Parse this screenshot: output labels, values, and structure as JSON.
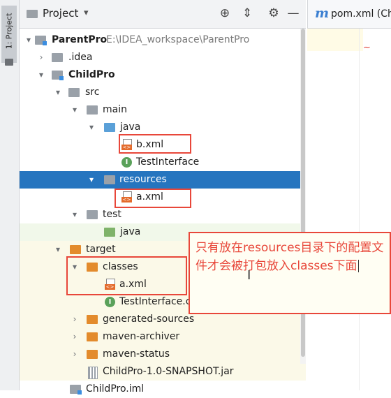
{
  "left_strip": {
    "project_tab_label": "1: Project"
  },
  "panel_header": {
    "title": "Project",
    "chevron": "▾",
    "buttons": [
      {
        "name": "locate-target-button",
        "glyph": "⊕"
      },
      {
        "name": "collapse-all-button",
        "glyph": "⇕"
      },
      {
        "name": "settings-button",
        "glyph": "⚙"
      },
      {
        "name": "hide-panel-button",
        "glyph": "—"
      }
    ]
  },
  "editor": {
    "tab_icon": "m",
    "tab_label": "pom.xml (Ch"
  },
  "tree": {
    "rows": [
      {
        "label": "ParentPro",
        "hint": "E:\\IDEA_workspace\\ParentPro"
      },
      {
        "label": ".idea"
      },
      {
        "label": "ChildPro"
      },
      {
        "label": "src"
      },
      {
        "label": "main"
      },
      {
        "label": "java"
      },
      {
        "label": "b.xml"
      },
      {
        "label": "TestInterface"
      },
      {
        "label": "resources"
      },
      {
        "label": "a.xml"
      },
      {
        "label": "test"
      },
      {
        "label": "java"
      },
      {
        "label": "target"
      },
      {
        "label": "classes"
      },
      {
        "label": "a.xml"
      },
      {
        "label": "TestInterface.class"
      },
      {
        "label": "generated-sources"
      },
      {
        "label": "maven-archiver"
      },
      {
        "label": "maven-status"
      },
      {
        "label": "ChildPro-1.0-SNAPSHOT.jar"
      },
      {
        "label": "ChildPro.iml"
      }
    ]
  },
  "annotation": {
    "text": "只有放在resources目录下的配置文件才会被打包放入classes下面"
  },
  "colors": {
    "selection": "#2675bf",
    "highlight_red": "#e8473a",
    "folder_blue": "#5aa0d8",
    "folder_orange": "#e38b2c"
  }
}
